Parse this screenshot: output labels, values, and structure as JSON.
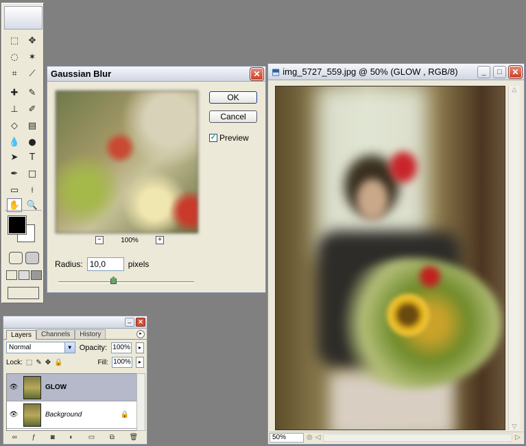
{
  "toolbox": {
    "tools": [
      {
        "name": "marquee-tool",
        "glyph": "⬚"
      },
      {
        "name": "move-tool",
        "glyph": "✥"
      },
      {
        "name": "lasso-tool",
        "glyph": "◌"
      },
      {
        "name": "magic-wand-tool",
        "glyph": "✶"
      },
      {
        "name": "crop-tool",
        "glyph": "⌗"
      },
      {
        "name": "slice-tool",
        "glyph": "⟋"
      },
      {
        "name": "healing-brush-tool",
        "glyph": "✚"
      },
      {
        "name": "brush-tool",
        "glyph": "✎"
      },
      {
        "name": "clone-stamp-tool",
        "glyph": "⊥"
      },
      {
        "name": "history-brush-tool",
        "glyph": "✐"
      },
      {
        "name": "eraser-tool",
        "glyph": "◇"
      },
      {
        "name": "gradient-tool",
        "glyph": "▤"
      },
      {
        "name": "blur-tool",
        "glyph": "💧"
      },
      {
        "name": "dodge-tool",
        "glyph": "●"
      },
      {
        "name": "path-selection-tool",
        "glyph": "➤"
      },
      {
        "name": "type-tool",
        "glyph": "T"
      },
      {
        "name": "pen-tool",
        "glyph": "✒"
      },
      {
        "name": "shape-tool",
        "glyph": "□"
      },
      {
        "name": "notes-tool",
        "glyph": "▭"
      },
      {
        "name": "eyedropper-tool",
        "glyph": "⟊"
      },
      {
        "name": "hand-tool",
        "glyph": "✋"
      },
      {
        "name": "zoom-tool",
        "glyph": "🔍"
      }
    ]
  },
  "gaussian_blur": {
    "title": "Gaussian Blur",
    "close_glyph": "✕",
    "zoom_out_glyph": "−",
    "zoom_level": "100%",
    "zoom_in_glyph": "+",
    "ok_label": "OK",
    "cancel_label": "Cancel",
    "preview_label": "Preview",
    "preview_checked_glyph": "✓",
    "radius_label": "Radius:",
    "radius_value": "10,0",
    "radius_unit": "pixels"
  },
  "document": {
    "title": "img_5727_559.jpg @ 50% (GLOW , RGB/8)",
    "icon_glyph": "⬒",
    "minimize_glyph": "_",
    "maximize_glyph": "□",
    "close_glyph": "✕",
    "zoom_value": "50%",
    "nav_glyph": "◎",
    "scroll_left_glyph": "◁",
    "scroll_right_glyph": "▷",
    "scroll_up_glyph": "△",
    "scroll_down_glyph": "▽"
  },
  "layers_panel": {
    "minimize_glyph": "–",
    "close_glyph": "✕",
    "tabs": [
      "Layers",
      "Channels",
      "History"
    ],
    "menu_glyph": "▸",
    "blend_mode": "Normal",
    "blend_arrow_glyph": "▼",
    "opacity_label": "Opacity:",
    "opacity_value": "100%",
    "lock_label": "Lock:",
    "lock_glyphs": [
      "⬚",
      "✎",
      "✥",
      "🔒"
    ],
    "fill_label": "Fill:",
    "fill_value": "100%",
    "step_glyph": "▸",
    "eye_glyph": "👁",
    "layers": [
      {
        "name": "GLOW",
        "selected": true
      },
      {
        "name": "Background",
        "selected": false,
        "locked_glyph": "🔒"
      }
    ],
    "bottom_icons": [
      "∞",
      "ƒ",
      "◙",
      "◐",
      "▭",
      "⧉",
      "🗑"
    ]
  }
}
